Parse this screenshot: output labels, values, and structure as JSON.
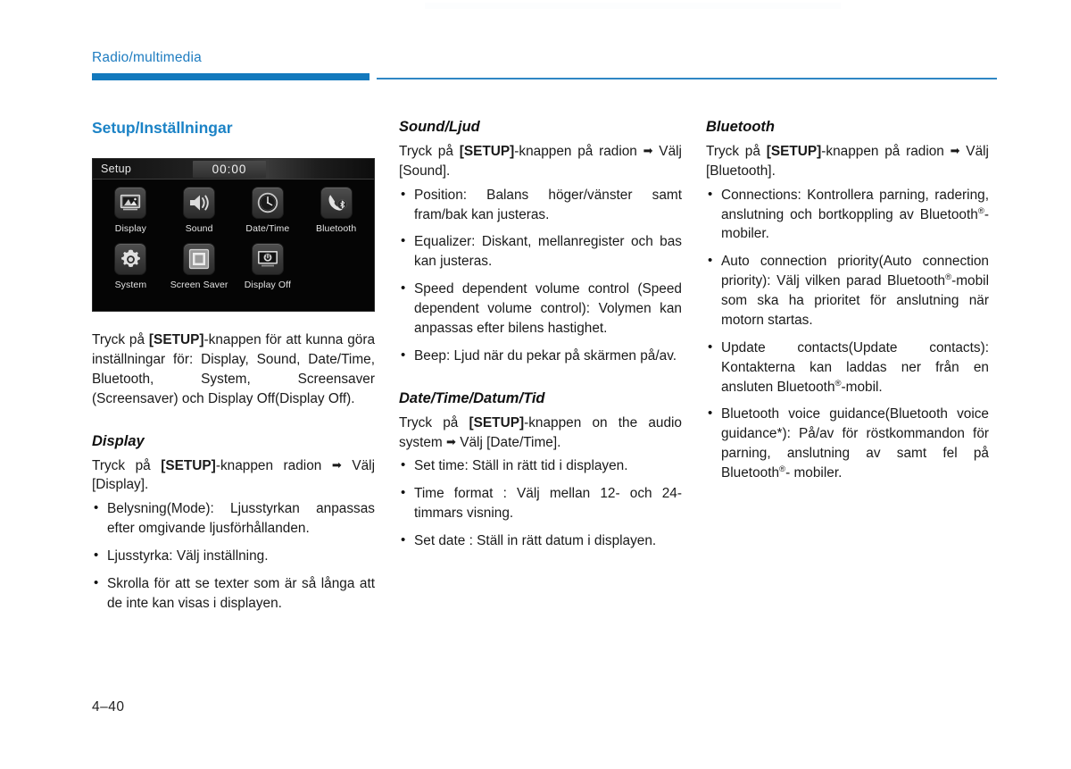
{
  "header": {
    "title": "Radio/multimedia",
    "accent_color": "#1379bd"
  },
  "page_number": "4–40",
  "left_column": {
    "section_title": "Setup/Inställningar",
    "headunit": {
      "screen_title": "Setup",
      "clock": "00:00",
      "tiles": [
        {
          "label": "Display",
          "icon": "picture-icon"
        },
        {
          "label": "Sound",
          "icon": "speaker-icon"
        },
        {
          "label": "Date/Time",
          "icon": "clock-icon"
        },
        {
          "label": "Bluetooth",
          "icon": "bluetooth-phone-icon"
        },
        {
          "label": "System",
          "icon": "gear-icon"
        },
        {
          "label": "Screen Saver",
          "icon": "screensaver-icon"
        },
        {
          "label": "Display Off",
          "icon": "display-off-icon"
        }
      ]
    },
    "intro_pre": "Tryck på ",
    "intro_bold": "[SETUP]",
    "intro_post": "-knappen för att kunna göra inställningar för: Display, Sound, Date/Time, Bluetooth, System, Screensaver (Screensaver) och Display Off(Display Off).",
    "display": {
      "heading": "Display",
      "intro_pre": "Tryck på ",
      "intro_bold": "[SETUP]",
      "intro_post": "-knappen radion ",
      "intro_post2": " Välj [Display].",
      "bullets": [
        "Belysning(Mode): Ljusstyrkan anpassas efter omgivande ljusförhållanden.",
        "Ljusstyrka: Välj inställning.",
        "Skrolla för att se texter som är så långa att de inte kan visas i displayen."
      ]
    }
  },
  "mid_column": {
    "sound": {
      "heading": "Sound/Ljud",
      "intro_pre": "Tryck på ",
      "intro_bold": "[SETUP]",
      "intro_post": "-knappen på radion ",
      "intro_post2": " Välj [Sound].",
      "bullets": [
        "Position: Balans höger/vänster samt fram/bak kan justeras.",
        "Equalizer: Diskant, mellanregister och bas kan justeras.",
        "Speed dependent volume control (Speed dependent volume control): Volymen kan anpassas efter bilens hastighet.",
        "Beep: Ljud när du pekar på skärmen på/av."
      ]
    },
    "datetime": {
      "heading": "Date/Time/Datum/Tid",
      "intro_pre": "Tryck på ",
      "intro_bold": "[SETUP]",
      "intro_post": "-knappen on the audio system ",
      "intro_post2": " Välj [Date/Time].",
      "bullets": [
        "Set time: Ställ in rätt tid i displayen.",
        "Time format : Välj mellan 12- och 24-timmars visning.",
        "Set date : Ställ in rätt datum i displayen."
      ]
    }
  },
  "right_column": {
    "bluetooth": {
      "heading": "Bluetooth",
      "intro_pre": "Tryck på ",
      "intro_bold": "[SETUP]",
      "intro_post": "-knappen på radion ",
      "intro_post2": " Välj [Bluetooth].",
      "bullets": [
        {
          "pre": "Connections: Kontrollera parning, radering, anslutning och bortkoppling av Bluetooth",
          "reg": "®",
          "post": "-mobiler."
        },
        {
          "pre": "Auto connection priority(Auto connection priority): Välj vilken parad Bluetooth",
          "reg": "®",
          "post": "-mobil som ska ha prioritet för anslutning när motorn startas."
        },
        {
          "pre": "Update contacts(Update contacts): Kontakterna kan laddas ner från en ansluten Bluetooth",
          "reg": "®",
          "post": "-mobil."
        },
        {
          "pre": "Bluetooth voice guidance(Bluetooth voice guidance*): På/av för röstkommandon för parning, anslutning av samt fel på Bluetooth",
          "reg": "®",
          "post": "- mobiler."
        }
      ]
    }
  },
  "glyphs": {
    "arrow": "➡"
  }
}
